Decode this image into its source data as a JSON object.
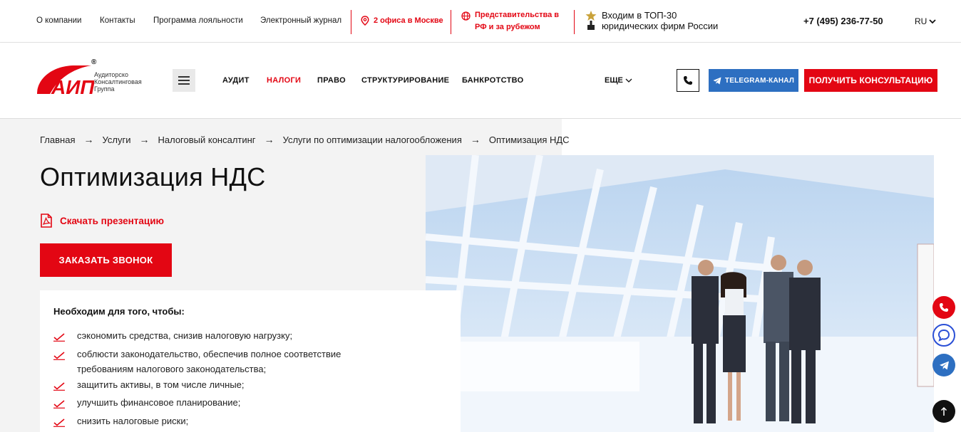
{
  "topbar": {
    "links": [
      "О компании",
      "Контакты",
      "Программа лояльности",
      "Электронный журнал"
    ],
    "offices": "2 офиса в Москве",
    "reps_line1": "Представительства в",
    "reps_line2": "РФ и за рубежом",
    "top30_line1": "Входим в ТОП-30",
    "top30_line2": "юридических фирм России",
    "phone": "+7 (495) 236-77-50",
    "lang": "RU"
  },
  "header": {
    "logo_text": "АИП",
    "logo_sub_1": "Аудиторско",
    "logo_sub_2": "Консалтинговая",
    "logo_sub_3": "Группа",
    "nav": [
      "АУДИТ",
      "НАЛОГИ",
      "ПРАВО",
      "СТРУКТУРИРОВАНИЕ",
      "БАНКРОТСТВО"
    ],
    "nav_active": "НАЛОГИ",
    "more": "ЕЩЕ",
    "telegram": "TELEGRAM-КАНАЛ",
    "consult": "ПОЛУЧИТЬ КОНСУЛЬТАЦИЮ"
  },
  "breadcrumbs": [
    "Главная",
    "Услуги",
    "Налоговый консалтинг",
    "Услуги по оптимизации налогообложения",
    "Оптимизация НДС"
  ],
  "page": {
    "title": "Оптимизация НДС",
    "download": "Скачать презентацию",
    "call": "ЗАКАЗАТЬ ЗВОНОК"
  },
  "card": {
    "title": "Необходим для того, чтобы:",
    "items": [
      "сэкономить средства, снизив налоговую нагрузку;",
      "соблюсти законодательство, обеспечив полное соответствие требованиям налогового законодательства;",
      "защитить активы, в том числе личные;",
      "улучшить финансовое планирование;",
      "снизить налоговые риски;"
    ]
  },
  "colors": {
    "accent": "#e30613",
    "telegram": "#2d6fc1"
  }
}
